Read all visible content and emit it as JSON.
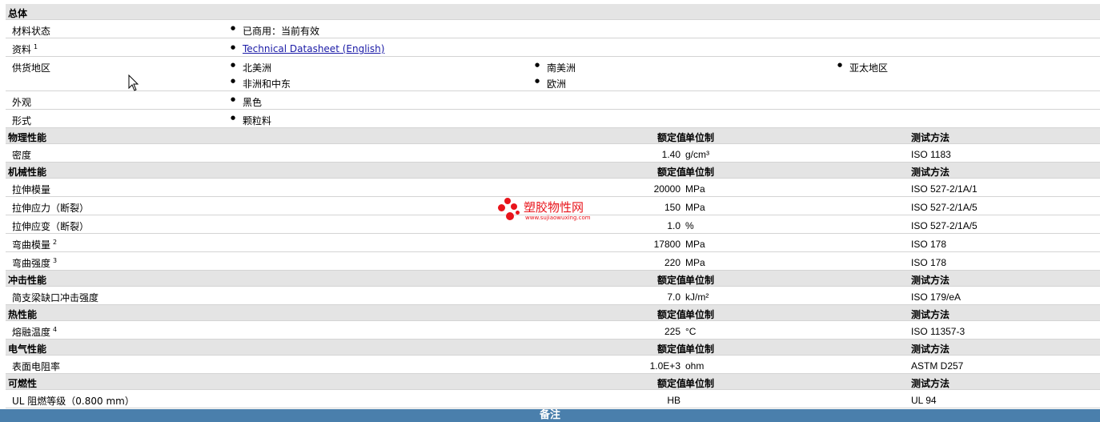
{
  "general": {
    "title": "总体",
    "status_label": "材料状态",
    "status_value": "已商用：当前有效",
    "docs_label": "资料",
    "docs_sup": "1",
    "docs_link": "Technical Datasheet (English)",
    "regions_label": "供货地区",
    "regions": [
      "北美洲",
      "南美洲",
      "亚太地区",
      "非洲和中东",
      "欧洲"
    ],
    "appearance_label": "外观",
    "appearance_value": "黑色",
    "form_label": "形式",
    "form_value": "颗粒料"
  },
  "columns": {
    "nominal": "额定值",
    "unit": "单位制",
    "method": "测试方法"
  },
  "sections": [
    {
      "title": "物理性能",
      "rows": [
        {
          "label": "密度",
          "sup": "",
          "value": "1.40",
          "unit": "g/cm³",
          "method": "ISO 1183"
        }
      ]
    },
    {
      "title": "机械性能",
      "rows": [
        {
          "label": "拉伸模量",
          "sup": "",
          "value": "20000",
          "unit": "MPa",
          "method": "ISO 527-2/1A/1"
        },
        {
          "label": "拉伸应力（断裂）",
          "sup": "",
          "value": "150",
          "unit": "MPa",
          "method": "ISO 527-2/1A/5"
        },
        {
          "label": "拉伸应变（断裂）",
          "sup": "",
          "value": "1.0",
          "unit": "%",
          "method": "ISO 527-2/1A/5"
        },
        {
          "label": "弯曲模量",
          "sup": "2",
          "value": "17800",
          "unit": "MPa",
          "method": "ISO 178"
        },
        {
          "label": "弯曲强度",
          "sup": "3",
          "value": "220",
          "unit": "MPa",
          "method": "ISO 178"
        }
      ]
    },
    {
      "title": "冲击性能",
      "rows": [
        {
          "label": "简支梁缺口冲击强度",
          "sup": "",
          "value": "7.0",
          "unit": "kJ/m²",
          "method": "ISO 179/eA"
        }
      ]
    },
    {
      "title": "热性能",
      "rows": [
        {
          "label": "熔融温度",
          "sup": "4",
          "value": "225",
          "unit": "°C",
          "method": "ISO 11357-3"
        }
      ]
    },
    {
      "title": "电气性能",
      "rows": [
        {
          "label": "表面电阻率",
          "sup": "",
          "value": "1.0E+3",
          "unit": "ohm",
          "method": "ASTM D257"
        }
      ]
    },
    {
      "title": "可燃性",
      "rows": [
        {
          "label": "UL 阻燃等级（0.800 mm）",
          "sup": "",
          "value": "HB",
          "unit": "",
          "method": "UL 94"
        }
      ]
    }
  ],
  "footer": "备注",
  "watermark": {
    "brand": "塑胶物性网",
    "url": "www.sujiaowuxing.com",
    "color": "#e8141b"
  },
  "colors": {
    "header_bg": "#e4e4e4",
    "footer_bg": "#4a7fac",
    "link": "#1a1aa6"
  }
}
